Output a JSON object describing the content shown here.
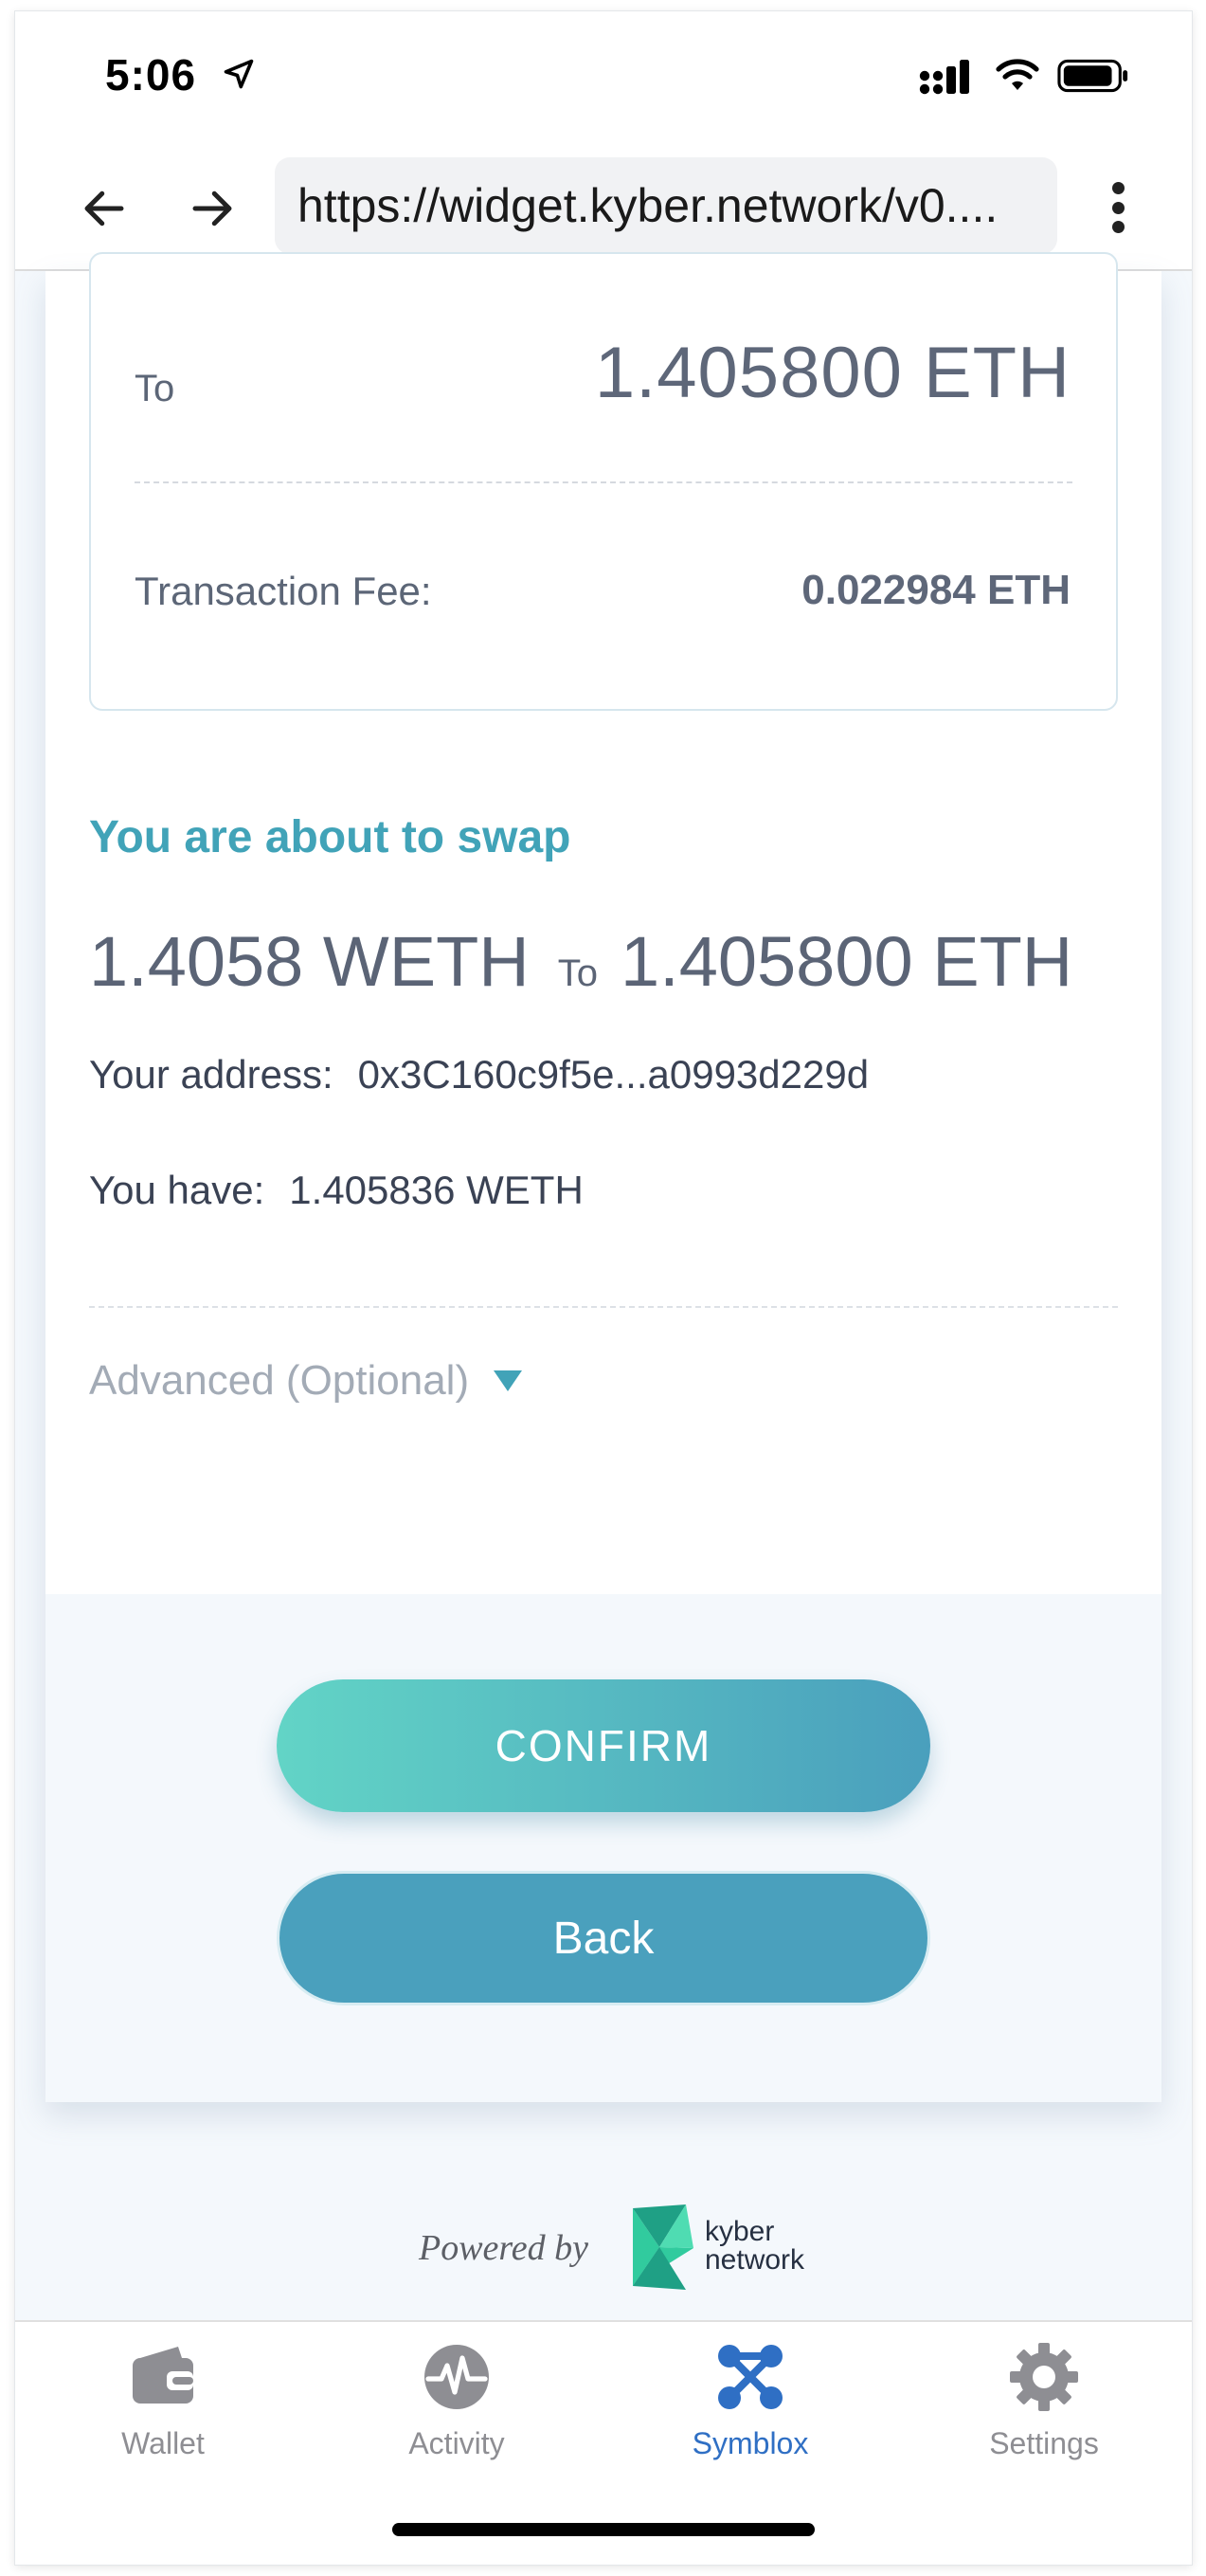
{
  "status_bar": {
    "time": "5:06",
    "icons": [
      "location-arrow-icon",
      "cellular-signal-icon",
      "wifi-icon",
      "battery-icon"
    ]
  },
  "browser": {
    "url": "https://widget.kyber.network/v0....",
    "back_icon": "arrow-left-icon",
    "forward_icon": "arrow-right-icon",
    "menu_icon": "more-vertical-icon"
  },
  "summary": {
    "to_label": "To",
    "to_value": "1.405800 ETH",
    "fee_label": "Transaction Fee:",
    "fee_value": "0.022984 ETH"
  },
  "swap": {
    "heading": "You are about to swap",
    "from_amount": "1.4058 WETH",
    "to_word": "To",
    "to_amount": "1.405800 ETH",
    "address_label": "Your address:",
    "address_value": "0x3C160c9f5e...a0993d229d",
    "have_label": "You have:",
    "have_value": "1.405836 WETH",
    "advanced_label": "Advanced (Optional)"
  },
  "actions": {
    "confirm_label": "CONFIRM",
    "back_label": "Back"
  },
  "footer": {
    "powered_by": "Powered by",
    "brand_line1": "kyber",
    "brand_line2": "network"
  },
  "tabs": [
    {
      "label": "Wallet",
      "icon": "wallet-icon",
      "active": false
    },
    {
      "label": "Activity",
      "icon": "activity-icon",
      "active": false
    },
    {
      "label": "Symblox",
      "icon": "symblox-icon",
      "active": true
    },
    {
      "label": "Settings",
      "icon": "gear-icon",
      "active": false
    }
  ],
  "colors": {
    "accent": "#41a3b8",
    "button_gradient_start": "#62d4c6",
    "button_gradient_end": "#4a9fbd",
    "back_button": "#4aa0bd",
    "active_tab": "#2f6fc4",
    "inactive_tab": "#8e8e93",
    "kyber_green": "#31cb9e"
  }
}
